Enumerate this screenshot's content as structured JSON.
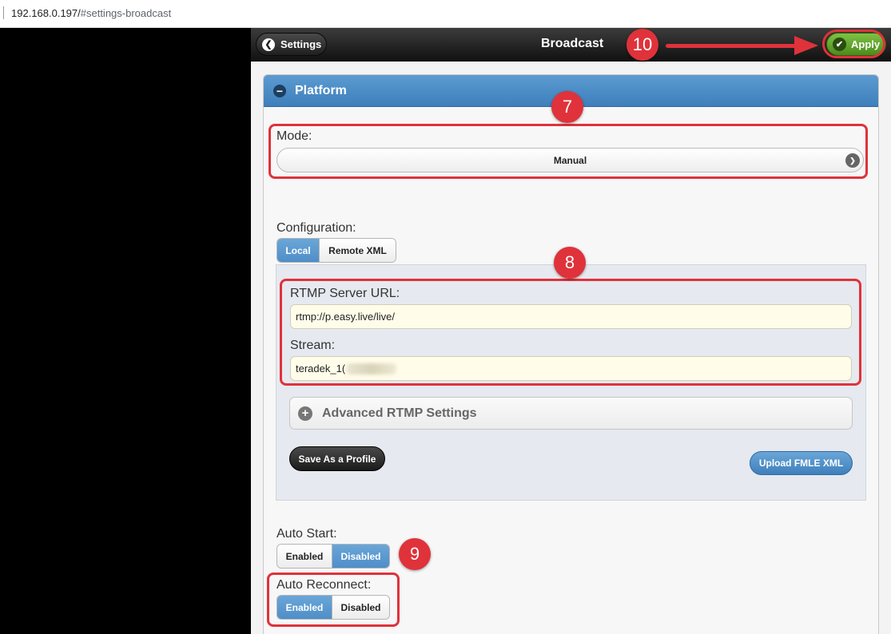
{
  "browser": {
    "url_host": "192.168.0.197/",
    "url_path": "#settings-broadcast"
  },
  "header": {
    "back_label": "Settings",
    "title": "Broadcast",
    "apply_label": "Apply"
  },
  "platform": {
    "header_label": "Platform",
    "mode_label": "Mode:",
    "mode_value": "Manual",
    "configuration_label": "Configuration:",
    "configuration_options": [
      "Local",
      "Remote XML"
    ],
    "configuration_selected": "Local",
    "rtmp_url_label": "RTMP Server URL:",
    "rtmp_url_value": "rtmp://p.easy.live/live/",
    "stream_label": "Stream:",
    "stream_value": "teradek_1(",
    "advanced_label": "Advanced RTMP Settings",
    "save_profile_label": "Save As a Profile",
    "upload_label": "Upload FMLE XML",
    "auto_start_label": "Auto Start:",
    "auto_start_options": [
      "Enabled",
      "Disabled"
    ],
    "auto_start_selected": "Disabled",
    "auto_reconnect_label": "Auto Reconnect:",
    "auto_reconnect_options": [
      "Enabled",
      "Disabled"
    ],
    "auto_reconnect_selected": "Enabled"
  },
  "annotations": {
    "badge_7": "7",
    "badge_8": "8",
    "badge_9": "9",
    "badge_10": "10"
  },
  "colors": {
    "accent_blue": "#4f8ec8",
    "apply_green": "#5fa22a",
    "annotation_red": "#e0323a"
  }
}
